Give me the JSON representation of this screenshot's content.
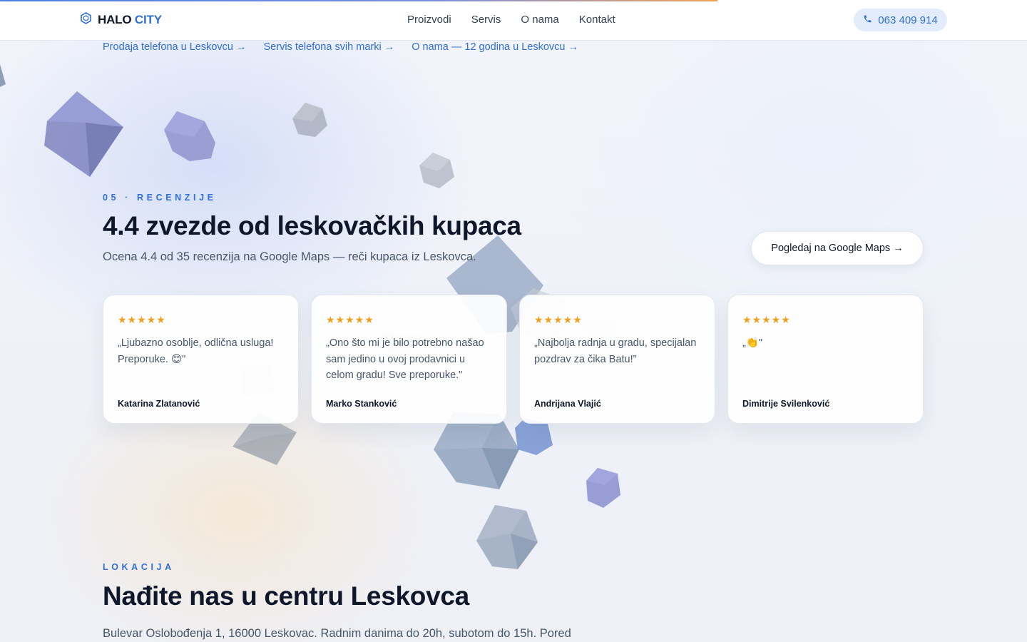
{
  "header": {
    "logo_word1": "HALO",
    "logo_word2": "CITY",
    "nav": [
      "Proizvodi",
      "Servis",
      "O nama",
      "Kontakt"
    ],
    "phone": "063 409 914"
  },
  "quick_links": [
    "Prodaja telefona u Leskovcu →",
    "Servis telefona svih marki →",
    "O nama — 12 godina u Leskovcu →"
  ],
  "reviews": {
    "eyebrow": "05 · RECENZIJE",
    "title": "4.4 zvezde od leskovačkih kupaca",
    "subtitle": "Ocena 4.4 od 35 recenzija na Google Maps — reči kupaca iz Leskovca.",
    "cta": "Pogledaj na Google Maps →",
    "items": [
      {
        "stars": "★★★★★",
        "quote": "„Ljubazno osoblje, odlična usluga! Preporuke. 😊\"",
        "author": "Katarina Zlatanović"
      },
      {
        "stars": "★★★★★",
        "quote": "„Ono što mi je bilo potrebno našao sam jedino u ovoj prodavnici u celom gradu! Sve preporuke.\"",
        "author": "Marko Stanković"
      },
      {
        "stars": "★★★★★",
        "quote": "„Najbolja radnja u gradu, specijalan pozdrav za čika Batu!\"",
        "author": "Andrijana Vlajić"
      },
      {
        "stars": "★★★★★",
        "quote": "„👏\"",
        "author": "Dimitrije Svilenković"
      }
    ]
  },
  "location": {
    "eyebrow": "LOKACIJA",
    "title": "Nađite nas u centru Leskovca",
    "text": "Bulevar Oslobođenja 1, 16000 Leskovac. Radnim danima do 20h, subotom do 15h. Pored"
  },
  "colors": {
    "accent": "#2f6fd6",
    "star": "#f0a020",
    "ink": "#0f172a"
  },
  "icons": [
    "hexagon-logo-icon",
    "phone-icon"
  ]
}
